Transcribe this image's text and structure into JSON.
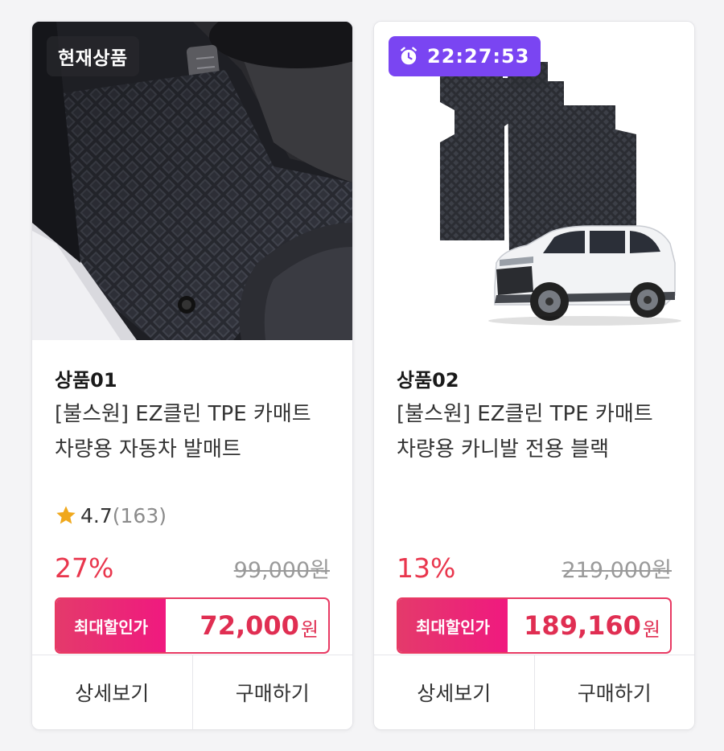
{
  "colors": {
    "accent_pink": "#e83a63",
    "discount_red": "#e9364d",
    "timer_purple": "#7a45f2",
    "star_gold": "#f0a81c"
  },
  "products": [
    {
      "badge": "현재상품",
      "badge_type": "current",
      "code": "상품01",
      "name": "[불스원] EZ클린 TPE 카매트 차량용 자동차 발매트",
      "rating": "4.7",
      "review_count": "(163)",
      "discount": "27%",
      "original_price": "99,000원",
      "max_label": "최대할인가",
      "max_price": "72,000",
      "currency": "원",
      "detail_label": "상세보기",
      "buy_label": "구매하기"
    },
    {
      "badge": "22:27:53",
      "badge_type": "timer",
      "badge_icon": "alarm-clock-icon",
      "code": "상품02",
      "name": "[불스원] EZ클린 TPE 카매트 차량용 카니발 전용 블랙",
      "discount": "13%",
      "original_price": "219,000원",
      "max_label": "최대할인가",
      "max_price": "189,160",
      "currency": "원",
      "detail_label": "상세보기",
      "buy_label": "구매하기"
    }
  ]
}
